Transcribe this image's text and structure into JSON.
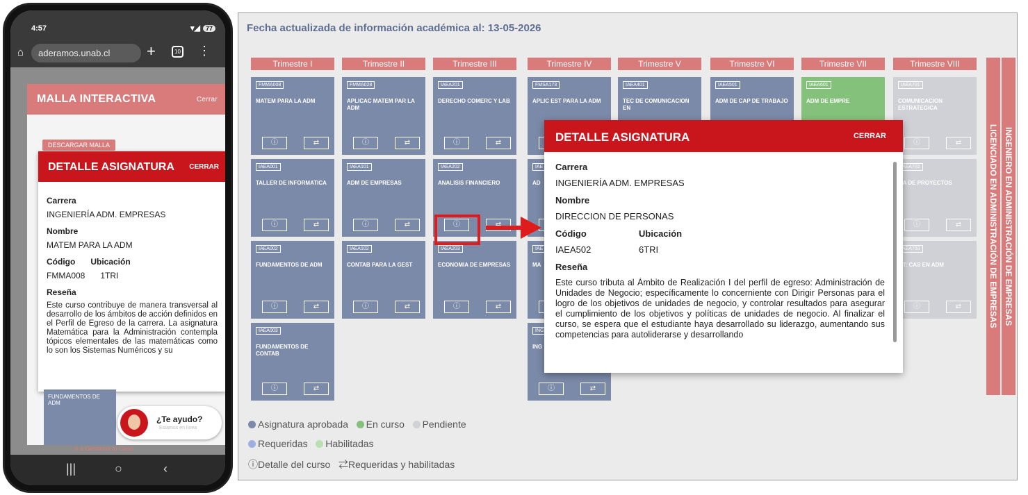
{
  "phone": {
    "status": {
      "time": "4:57",
      "battery": "77"
    },
    "url": "aderamos.unab.cl",
    "malla_title": "MALLA INTERACTIVA",
    "malla_close": "Cerrar",
    "download_label": "DESCARGAR MALLA",
    "detail": {
      "title": "DETALLE ASIGNATURA",
      "close": "CERRAR",
      "carrera_label": "Carrera",
      "carrera_value": "INGENIERÍA ADM. EMPRESAS",
      "nombre_label": "Nombre",
      "nombre_value": "MATEM PARA LA ADM",
      "codigo_label": "Código",
      "codigo_value": "FMMA008",
      "ubicacion_label": "Ubicación",
      "ubicacion_value": "1TRI",
      "resena_label": "Reseña",
      "resena_value": "Este curso contribuye de manera transversal al desarrollo de los ámbitos de acción definidos en el Perfil de Egreso de la carrera. La asignatura Matemática para la Administración contempla tópicos elementales de las matemáticas como lo son los Sistemas Numéricos y su"
    },
    "tile_name": "FUNDAMENTOS DE ADM",
    "help_title": "¿Te ayudo?",
    "help_sub": "Estamos en línea",
    "gestiona": "Ir a Gestiona tu Caso"
  },
  "desktop": {
    "updated": "Fecha actualizada de información académica al: 13-05-2026",
    "trimestres": [
      "Trimestre I",
      "Trimestre II",
      "Trimestre III",
      "Trimestre IV",
      "Trimestre V",
      "Trimestre VI",
      "Trimestre VII",
      "Trimestre VIII"
    ],
    "tiles": [
      {
        "code": "FMMA008",
        "name": "MATEM PARA LA ADM",
        "state": "approved"
      },
      {
        "code": "FMMA028",
        "name": "APLICAC MATEM PAR LA ADM",
        "state": "approved"
      },
      {
        "code": "IAEA201",
        "name": "DERECHO COMERC Y LAB",
        "state": "approved"
      },
      {
        "code": "FMSA173",
        "name": "APLIC EST PARA LA ADM",
        "state": "approved"
      },
      {
        "code": "IAEA401",
        "name": "TEC DE COMUNICACION EN",
        "state": "approved"
      },
      {
        "code": "IAEA501",
        "name": "ADM DE CAP DE TRABAJO",
        "state": "approved"
      },
      {
        "code": "IAEA601",
        "name": "ADM DE EMPRE",
        "state": "current"
      },
      {
        "code": "IAEA701",
        "name": "COMUNICACION ESTRATEGICA",
        "state": "pending"
      },
      {
        "code": "IAEA001",
        "name": "TALLER DE INFORMATICA",
        "state": "approved"
      },
      {
        "code": "IAEA101",
        "name": "ADM DE EMPRESAS",
        "state": "approved"
      },
      {
        "code": "IAEA202",
        "name": "ANALISIS FINANCIERO",
        "state": "approved"
      },
      {
        "code": "IAE",
        "name": "AD",
        "state": "approved"
      },
      {
        "code": "IAEA702",
        "name": "...A DE PROYECTOS",
        "state": "pending"
      },
      {
        "code": "IAEA002",
        "name": "FUNDAMENTOS DE ADM",
        "state": "approved"
      },
      {
        "code": "IAEA102",
        "name": "CONTAB PARA LA GEST",
        "state": "approved"
      },
      {
        "code": "IAEA203",
        "name": "ECONOMIA DE EMPRESAS",
        "state": "approved"
      },
      {
        "code": "IAE",
        "name": "MA",
        "state": "approved"
      },
      {
        "code": "IAEA703",
        "name": "...T: CAS EN ADM",
        "state": "pending"
      },
      {
        "code": "IAEA003",
        "name": "FUNDAMENTOS DE CONTAB",
        "state": "approved"
      },
      {
        "code": "ING",
        "name": "ING",
        "state": "approved"
      }
    ],
    "vertical_1": "LICENCIADO EN ADMINISTRACIÓN DE EMPRESAS",
    "vertical_2": "INGENIERO EN ADMINISTRACIÓN DE EMPRESAS",
    "detail": {
      "title": "DETALLE ASIGNATURA",
      "close": "CERRAR",
      "carrera_label": "Carrera",
      "carrera_value": "INGENIERÍA ADM. EMPRESAS",
      "nombre_label": "Nombre",
      "nombre_value": "DIRECCION DE PERSONAS",
      "codigo_label": "Código",
      "codigo_value": "IAEA502",
      "ubicacion_label": "Ubicación",
      "ubicacion_value": "6TRI",
      "resena_label": "Reseña",
      "resena_value": "Este curso tributa al Ámbito de Realización I del perfil de egreso: Administración de Unidades de Negocio; específicamente lo concerniente con Dirigir Personas para el logro de los objetivos de unidades de negocio, y controlar resultados para asegurar el cumplimiento de los objetivos y políticas de unidades de negocio. Al finalizar el curso, se espera que el estudiante haya desarrollado su liderazgo, aumentando sus competencias para autoliderarse y desarrollando"
    },
    "legend": {
      "approved": "Asignatura aprobada",
      "current": "En curso",
      "pending": "Pendiente",
      "required": "Requeridas",
      "enabled": "Habilitadas",
      "detail_hint": "Detalle del curso",
      "req_hint": "Requeridas y habilitadas"
    },
    "colors": {
      "approved": "#7b8aa8",
      "current": "#84c27c",
      "pending": "#cfd1d6",
      "accent": "#c8161c",
      "header": "#d97b7b"
    },
    "icons": {
      "info": "info-icon",
      "swap": "swap-arrows-icon"
    }
  }
}
